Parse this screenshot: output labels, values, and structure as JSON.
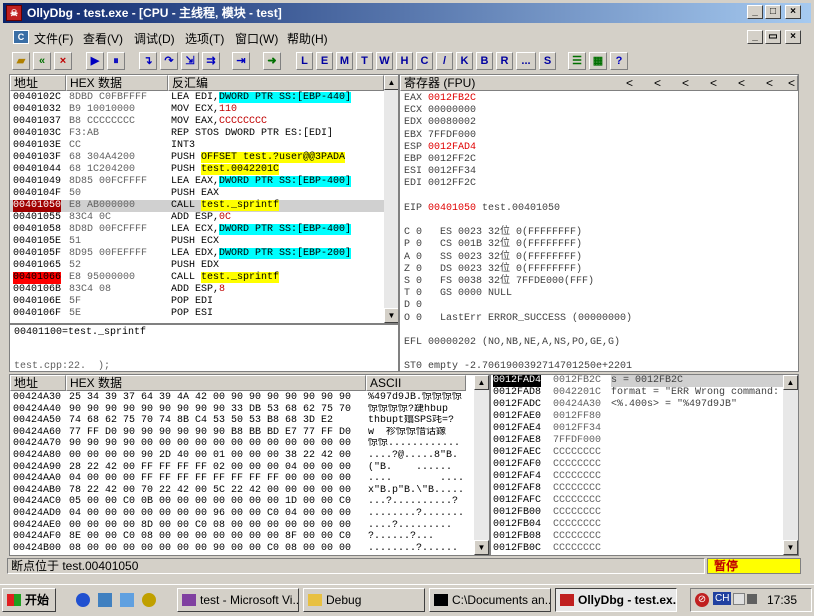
{
  "window": {
    "app_icon": "ollydbg-icon",
    "title": "OllyDbg - test.exe - [CPU - 主线程, 模块 - test]"
  },
  "menu": [
    "文件(F)",
    "查看(V)",
    "调试(D)",
    "选项(T)",
    "窗口(W)",
    "帮助(H)"
  ],
  "toolbar": {
    "letters": [
      "L",
      "E",
      "M",
      "T",
      "W",
      "H",
      "C",
      "/",
      "K",
      "B",
      "R",
      "...",
      "S"
    ]
  },
  "disasm": {
    "headers": {
      "addr": "地址",
      "hex": "HEX 数据",
      "dis": "反汇编"
    },
    "rows": [
      {
        "a": "0040102C",
        "h": "8DBD C0FBFFFF",
        "p": "LEA EDI,",
        "h1": "DWORD PTR SS:[EBP-440]",
        "s": ""
      },
      {
        "a": "00401032",
        "h": "B9 10010000",
        "p": "MOV ECX,",
        "h1": "",
        "s": "110"
      },
      {
        "a": "00401037",
        "h": "B8 CCCCCCCC",
        "p": "MOV EAX,",
        "h1": "",
        "s": "CCCCCCCC"
      },
      {
        "a": "0040103C",
        "h": "F3:AB",
        "p": "REP STOS DWORD PTR ES:[EDI]",
        "h1": "",
        "s": ""
      },
      {
        "a": "0040103E",
        "h": "CC",
        "p": "INT3",
        "h1": "",
        "s": ""
      },
      {
        "a": "0040103F",
        "h": "68 304A4200",
        "p": "PUSH ",
        "h1": "",
        "y": "OFFSET test.?user@@3PADA"
      },
      {
        "a": "00401044",
        "h": "68 1C204200",
        "p": "PUSH ",
        "h1": "",
        "y": "test.0042201C"
      },
      {
        "a": "00401049",
        "h": "8D85 00FCFFFF",
        "p": "LEA EAX,",
        "h1": "DWORD PTR SS:[EBP-400]",
        "s": ""
      },
      {
        "a": "0040104F",
        "h": "50",
        "p": "PUSH EAX",
        "h1": "",
        "s": ""
      },
      {
        "a": "00401050",
        "h": "E8 AB000000",
        "p": "CALL ",
        "h1": "",
        "y": "test._sprintf",
        "sel": true
      },
      {
        "a": "00401055",
        "h": "83C4 0C",
        "p": "ADD ESP,",
        "h1": "",
        "s": "0C"
      },
      {
        "a": "00401058",
        "h": "8D8D 00FCFFFF",
        "p": "LEA ECX,",
        "h1": "DWORD PTR SS:[EBP-400]",
        "s": ""
      },
      {
        "a": "0040105E",
        "h": "51",
        "p": "PUSH ECX",
        "h1": "",
        "s": ""
      },
      {
        "a": "0040105F",
        "h": "8D95 00FEFFFF",
        "p": "LEA EDX,",
        "h1": "DWORD PTR SS:[EBP-200]",
        "s": ""
      },
      {
        "a": "00401065",
        "h": "52",
        "p": "PUSH EDX",
        "h1": "",
        "s": ""
      },
      {
        "a": "00401066",
        "h": "E8 95000000",
        "p": "CALL ",
        "h1": "",
        "y": "test._sprintf",
        "bp": true
      },
      {
        "a": "0040106B",
        "h": "83C4 08",
        "p": "ADD ESP,",
        "h1": "",
        "s": "8"
      },
      {
        "a": "0040106E",
        "h": "5F",
        "p": "POP EDI",
        "h1": "",
        "s": ""
      },
      {
        "a": "0040106F",
        "h": "5E",
        "p": "POP ESI",
        "h1": "",
        "s": ""
      }
    ],
    "info1": "00401100=test._sprintf",
    "info2": "test.cpp:22.  );"
  },
  "registers": {
    "header": "寄存器 (FPU)",
    "nav": [
      "<",
      "<",
      "<",
      "<",
      "<",
      "<",
      "<"
    ],
    "lines": [
      {
        "t": "EAX ",
        "r": "0012FB2C"
      },
      {
        "t": "ECX 00000000"
      },
      {
        "t": "EDX 00080002"
      },
      {
        "t": "EBX 7FFDF000"
      },
      {
        "t": "ESP ",
        "r": "0012FAD4"
      },
      {
        "t": "EBP 0012FF2C"
      },
      {
        "t": "ESI 0012FF34"
      },
      {
        "t": "EDI 0012FF2C"
      },
      {
        "t": ""
      },
      {
        "t": "EIP ",
        "r": "00401050",
        "t2": " test.00401050"
      },
      {
        "t": ""
      },
      {
        "t": "C 0   ES 0023 32位 0(FFFFFFFF)"
      },
      {
        "t": "P 0   CS 001B 32位 0(FFFFFFFF)"
      },
      {
        "t": "A 0   SS 0023 32位 0(FFFFFFFF)"
      },
      {
        "t": "Z 0   DS 0023 32位 0(FFFFFFFF)"
      },
      {
        "t": "S 0   FS 0038 32位 7FFDE000(FFF)"
      },
      {
        "t": "T 0   GS 0000 NULL"
      },
      {
        "t": "D 0"
      },
      {
        "t": "O 0   LastErr ERROR_SUCCESS (00000000)"
      },
      {
        "t": ""
      },
      {
        "t": "EFL 00000202 (NO,NB,NE,A,NS,PO,GE,G)"
      },
      {
        "t": ""
      },
      {
        "t": "ST0 empty -2.7061900392714701250e+2201"
      },
      {
        "t": "ST1 empty -UNORM DF04 032EDF08 00000000"
      },
      {
        "t": "ST2 empty +UNORM 0072 00610077 00740066"
      },
      {
        "t": "ST3 empty +UNORM 0072 006F0072 00000000"
      }
    ]
  },
  "dump": {
    "headers": {
      "addr": "地址",
      "hex": "HEX 数据",
      "ascii": "ASCII"
    },
    "rows": [
      {
        "a": "00424A30",
        "h": "25 34 39 37 64 39 4A 42 00 90 90 90 90 90 90 90",
        "s": "%497d9JB.惊惊惊惊"
      },
      {
        "a": "00424A40",
        "h": "90 90 90 90 90 90 90 90 90 33 DB 53 68 62 75 70",
        "s": "惊惊惊惊?踕hbup"
      },
      {
        "a": "00424A50",
        "h": "74 68 62 75 70 74 8B C4 53 50 53 B8 68 3D E2",
        "s": "thbupt嬆SPS竓=?"
      },
      {
        "a": "00424A60",
        "h": "77 FF D0 90 90 90 90 90 90 B8 BB BD E7 77 FF D0",
        "s": "w  袗惊惊惜话鐌"
      },
      {
        "a": "00424A70",
        "h": "90 90 90 90 00 00 00 00 00 00 00 00 00 00 00 00",
        "s": "惊惊............"
      },
      {
        "a": "00424A80",
        "h": "00 00 00 00 90 2D 40 00 01 00 00 00 38 22 42 00",
        "s": "....?@.....8\"B."
      },
      {
        "a": "00424A90",
        "h": "28 22 42 00 FF FF FF FF 02 00 00 00 04 00 00 00",
        "s": "(\"B.    ......"
      },
      {
        "a": "00424AA0",
        "h": "04 00 00 00 FF FF FF FF FF FF FF FF 00 00 00 00",
        "s": "....        ...."
      },
      {
        "a": "00424AB0",
        "h": "78 22 42 00 70 22 42 00 5C 22 42 00 00 00 00 00",
        "s": "x\"B.p\"B.\\\"B....."
      },
      {
        "a": "00424AC0",
        "h": "05 00 00 C0 0B 00 00 00 00 00 00 00 1D 00 00 C0",
        "s": "...?..........?"
      },
      {
        "a": "00424AD0",
        "h": "04 00 00 00 00 00 00 00 96 00 00 C0 04 00 00 00",
        "s": "........?......."
      },
      {
        "a": "00424AE0",
        "h": "00 00 00 00 8D 00 00 C0 08 00 00 00 00 00 00 00",
        "s": "....?........."
      },
      {
        "a": "00424AF0",
        "h": "8E 00 00 C0 08 00 00 00 00 00 00 00 8F 00 00 C0",
        "s": "?......?..."
      },
      {
        "a": "00424B00",
        "h": "08 00 00 00 00 00 00 00 90 00 00 C0 08 00 00 00",
        "s": "........?......"
      }
    ]
  },
  "stack": {
    "rows": [
      {
        "a": "0012FAD4",
        "v": "0012FB2C",
        "c": "s = 0012FB2C"
      },
      {
        "a": "0012FAD8",
        "v": "0042201C",
        "c": "format = \"ERR Wrong command:"
      },
      {
        "a": "0012FADC",
        "v": "00424A30",
        "c": "<%.400s> = \"%497d9JB\""
      },
      {
        "a": "0012FAE0",
        "v": "0012FF80",
        "c": ""
      },
      {
        "a": "0012FAE4",
        "v": "0012FF34",
        "c": ""
      },
      {
        "a": "0012FAE8",
        "v": "7FFDF000",
        "c": ""
      },
      {
        "a": "0012FAEC",
        "v": "CCCCCCCC",
        "c": ""
      },
      {
        "a": "0012FAF0",
        "v": "CCCCCCCC",
        "c": ""
      },
      {
        "a": "0012FAF4",
        "v": "CCCCCCCC",
        "c": ""
      },
      {
        "a": "0012FAF8",
        "v": "CCCCCCCC",
        "c": ""
      },
      {
        "a": "0012FAFC",
        "v": "CCCCCCCC",
        "c": ""
      },
      {
        "a": "0012FB00",
        "v": "CCCCCCCC",
        "c": ""
      },
      {
        "a": "0012FB04",
        "v": "CCCCCCCC",
        "c": ""
      },
      {
        "a": "0012FB08",
        "v": "CCCCCCCC",
        "c": ""
      },
      {
        "a": "0012FB0C",
        "v": "CCCCCCCC",
        "c": ""
      }
    ]
  },
  "status": {
    "text": "断点位于 test.00401050",
    "state": "暂停"
  },
  "taskbar": {
    "start": "开始",
    "tasks": [
      "test - Microsoft Vi...",
      "Debug",
      "C:\\Documents an...",
      "OllyDbg - test.ex..."
    ],
    "lang": "CH",
    "clock": "17:35"
  }
}
